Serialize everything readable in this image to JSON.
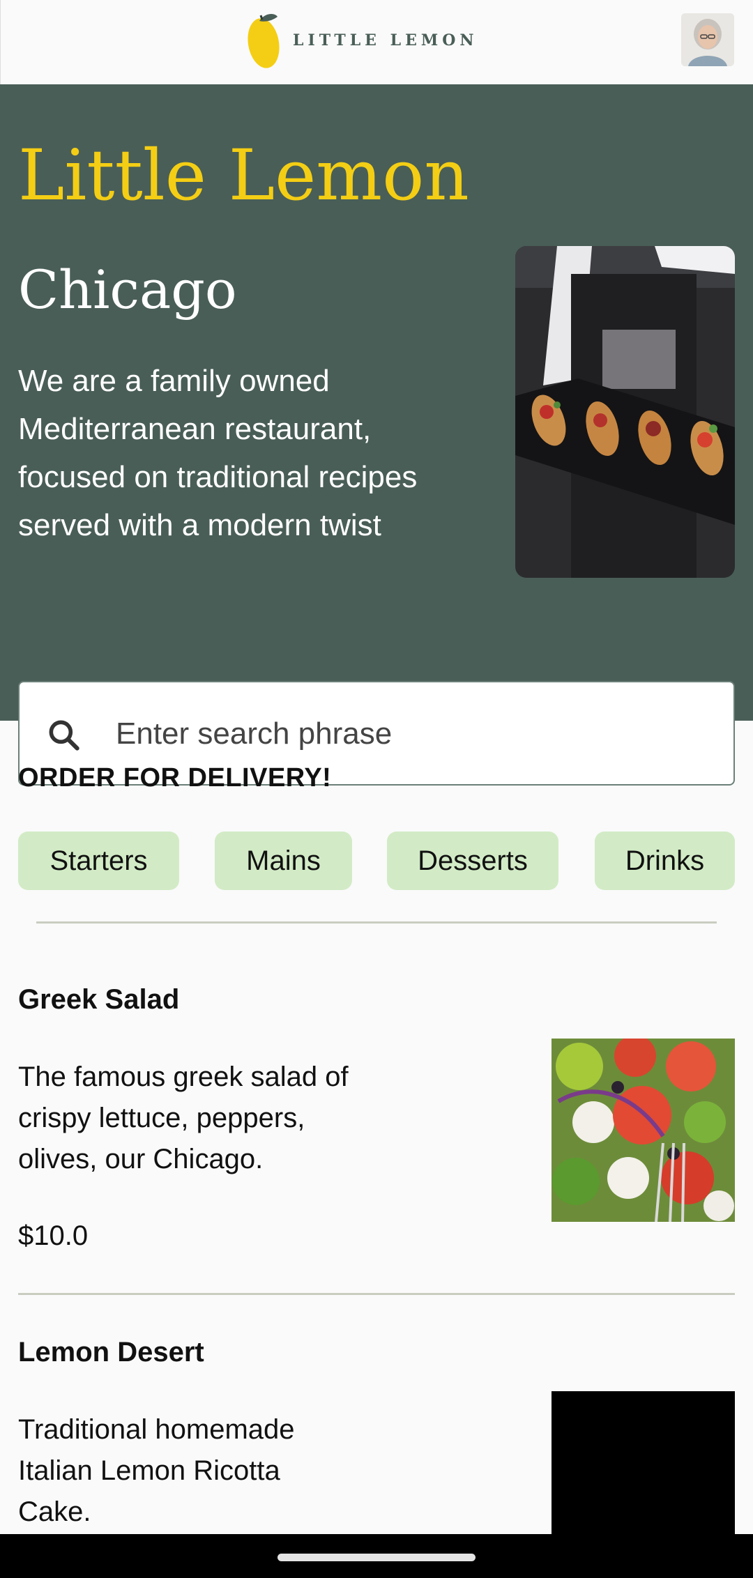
{
  "header": {
    "logo_text": "LITTLE LEMON",
    "logo_icon": "lemon-logo-icon",
    "avatar_icon": "profile-avatar"
  },
  "hero": {
    "title": "Little Lemon",
    "city": "Chicago",
    "description": "We are a family owned Mediterranean restaurant, focused on traditional recipes served with a modern twist",
    "image_icon": "hero-food-image"
  },
  "search": {
    "placeholder": "Enter search phrase",
    "value": "",
    "icon": "search-icon"
  },
  "order": {
    "title": "ORDER FOR DELIVERY!",
    "categories": [
      "Starters",
      "Mains",
      "Desserts",
      "Drinks"
    ]
  },
  "menu": [
    {
      "name": "Greek Salad",
      "description": "The famous greek salad of crispy lettuce, peppers, olives, our Chicago.",
      "price": "$10.0",
      "image": "greek-salad-image"
    },
    {
      "name": "Lemon Desert",
      "description": "Traditional homemade Italian Lemon Ricotta Cake.",
      "image": "lemon-dessert-image"
    }
  ],
  "colors": {
    "primary_green": "#495e57",
    "primary_yellow": "#f4ce14",
    "chip_bg": "#d2ebc6",
    "background": "#fafafa"
  }
}
